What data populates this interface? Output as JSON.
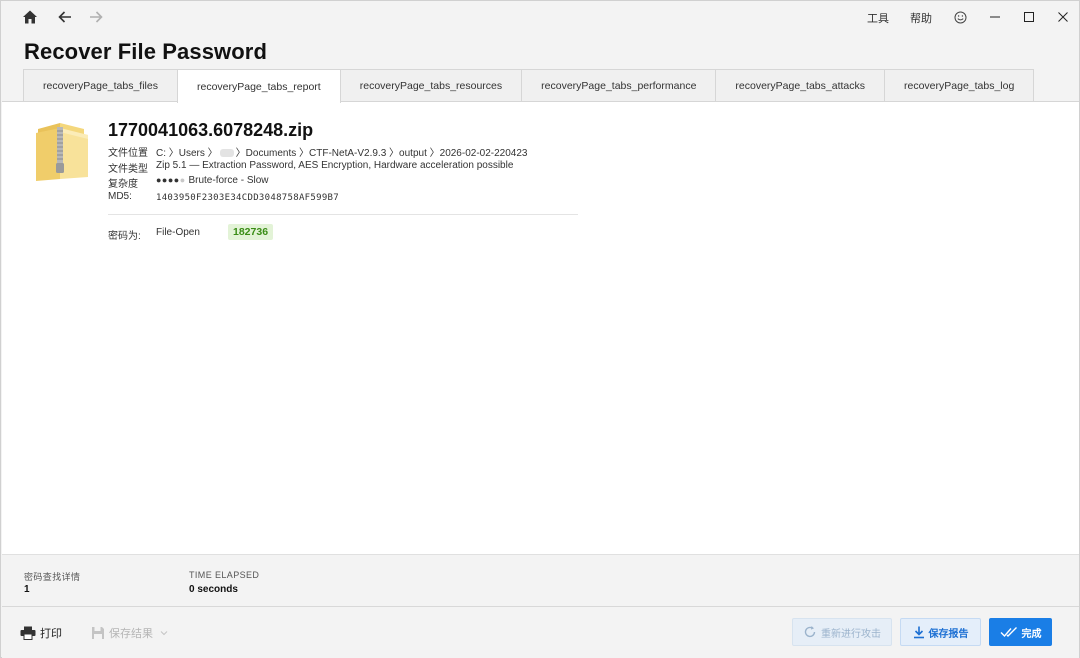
{
  "titlebar": {
    "tools_label": "工具",
    "help_label": "帮助"
  },
  "page": {
    "title": "Recover File Password"
  },
  "tabs": [
    {
      "label": "recoveryPage_tabs_files",
      "active": false
    },
    {
      "label": "recoveryPage_tabs_report",
      "active": true
    },
    {
      "label": "recoveryPage_tabs_resources",
      "active": false
    },
    {
      "label": "recoveryPage_tabs_performance",
      "active": false
    },
    {
      "label": "recoveryPage_tabs_attacks",
      "active": false
    },
    {
      "label": "recoveryPage_tabs_log",
      "active": false
    }
  ],
  "report": {
    "file_name": "1770041063.6078248.zip",
    "location_label": "文件位置",
    "location_prefix": "C: 〉Users 〉",
    "location_suffix": "〉Documents 〉CTF-NetA-V2.9.3 〉output 〉2026-02-02-220423",
    "type_label": "文件类型",
    "type_value": "Zip 5.1 — Extraction Password, AES Encryption, Hardware acceleration possible",
    "complexity_label": "复杂度",
    "complexity_dots": "●●●●",
    "complexity_dot_empty": "●",
    "complexity_value": "Brute-force - Slow",
    "md5_label": "MD5:",
    "md5_value": "1403950F2303E34CDD3048758AF599B7",
    "password_label": "密码为:",
    "password_mode": "File-Open",
    "password_value": "182736"
  },
  "stats": {
    "search_details_label": "密码查找详情",
    "search_details_value": "1",
    "time_elapsed_label": "TIME ELAPSED",
    "time_elapsed_value": "0 seconds"
  },
  "bottom": {
    "print_label": "打印",
    "save_result_label": "保存结果",
    "retry_label": "重新进行攻击",
    "save_report_label": "保存报告",
    "done_label": "完成"
  },
  "colors": {
    "accent": "#1a7ee6",
    "password_bg": "#e3f3d7",
    "password_fg": "#3a8d16"
  }
}
